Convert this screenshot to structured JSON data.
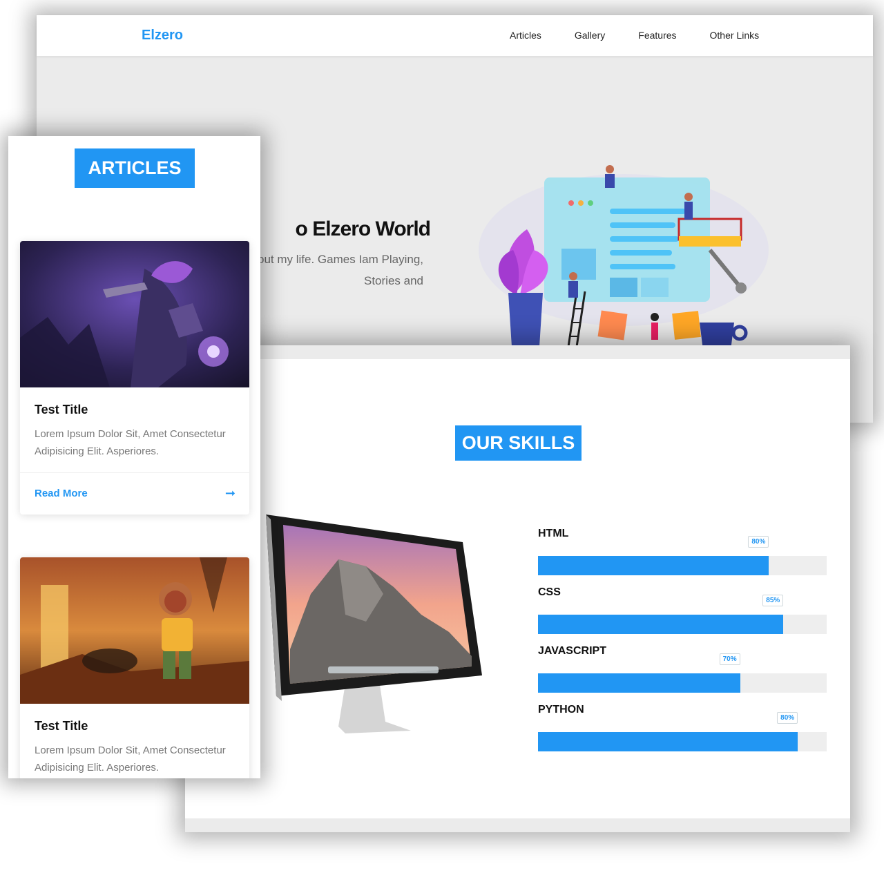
{
  "hero": {
    "logo": "Elzero",
    "nav": [
      "Articles",
      "Gallery",
      "Features",
      "Other Links"
    ],
    "title": "o Elzero World",
    "description": "re everything about my life. Games Iam Playing, Stories and"
  },
  "articles": {
    "heading": "ARTICLES",
    "cards": [
      {
        "title": "Test Title",
        "text": "Lorem Ipsum Dolor Sit, Amet Consectetur Adipisicing Elit. Asperiores.",
        "read_more": "Read More"
      },
      {
        "title": "Test Title",
        "text": "Lorem Ipsum Dolor Sit, Amet Consectetur Adipisicing Elit. Asperiores."
      }
    ]
  },
  "skills": {
    "heading": "OUR SKILLS",
    "items": [
      {
        "name": "HTML",
        "label": "80%",
        "fill": 0.8
      },
      {
        "name": "CSS",
        "label": "85%",
        "fill": 0.85
      },
      {
        "name": "JAVASCRIPT",
        "label": "70%",
        "fill": 0.7
      },
      {
        "name": "PYTHON",
        "label": "80%",
        "fill": 0.9
      }
    ]
  },
  "colors": {
    "accent": "#2196f3",
    "band": "#ebebeb"
  }
}
